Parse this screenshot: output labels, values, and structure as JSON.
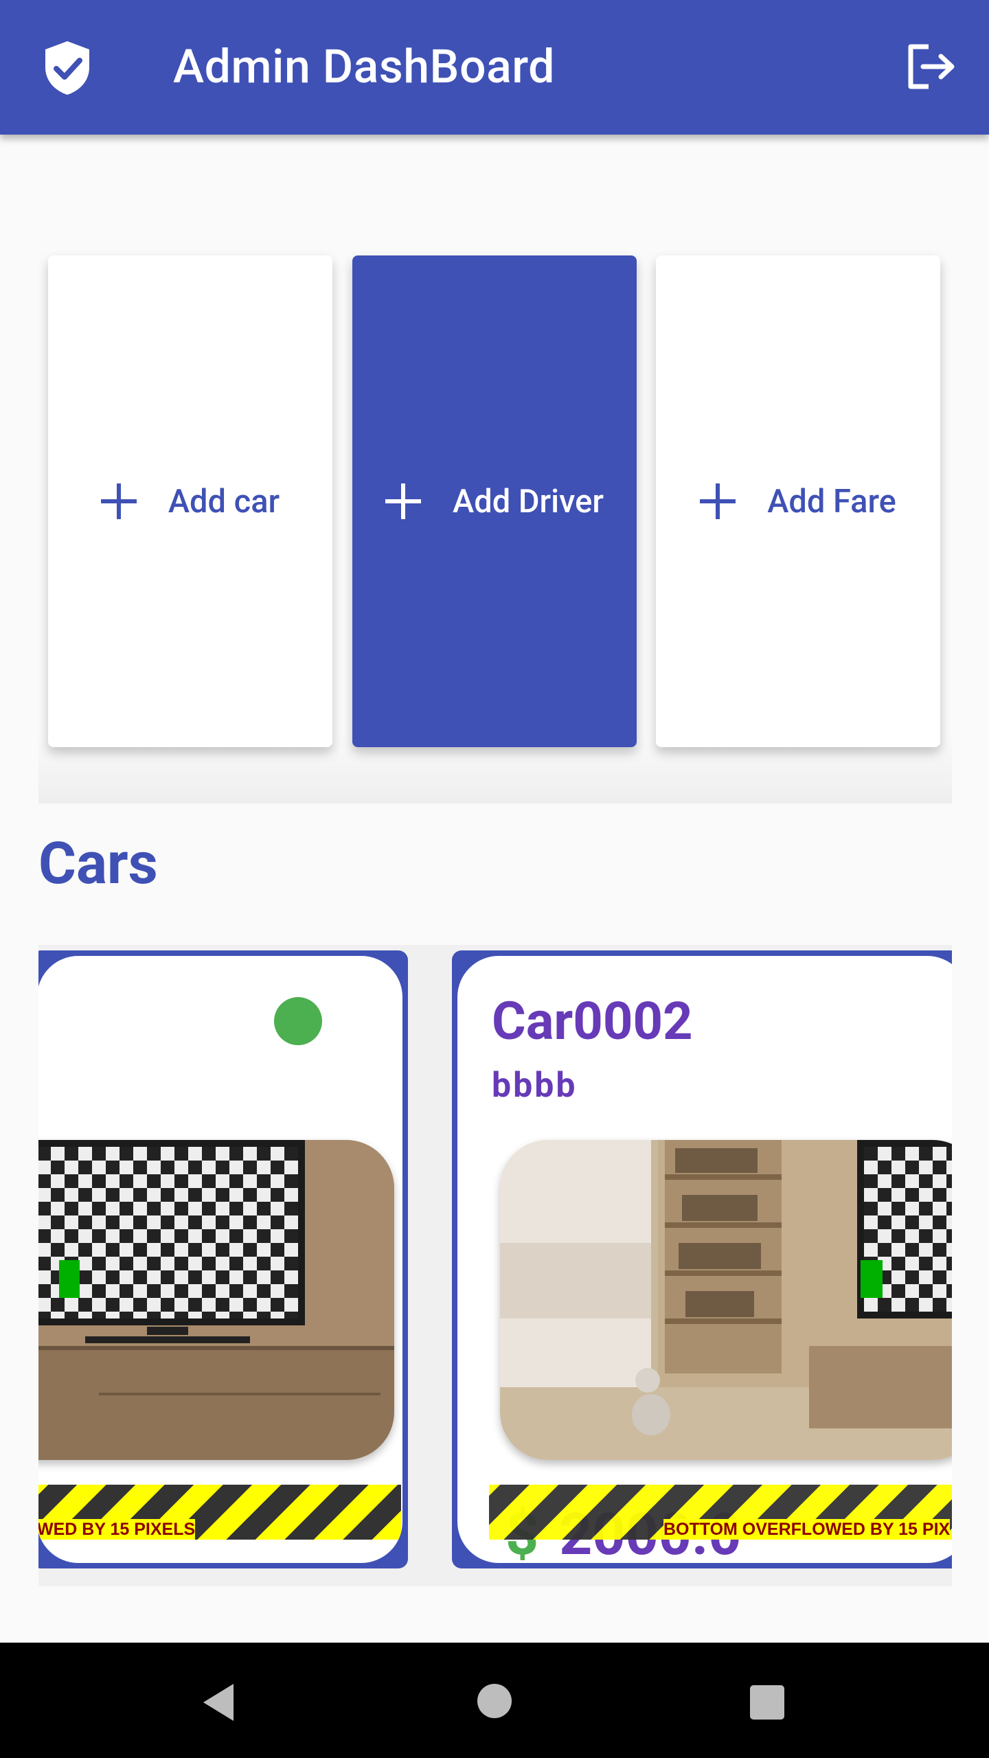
{
  "app_bar": {
    "title": "Admin DashBoard",
    "leading_icon": "verified-shield-icon",
    "trailing_icon": "logout-icon",
    "color": "#3f51b5"
  },
  "actions": [
    {
      "label": "Add car",
      "icon": "plus-icon",
      "style": "outlined"
    },
    {
      "label": "Add Driver",
      "icon": "plus-icon",
      "style": "filled"
    },
    {
      "label": "Add Fare",
      "icon": "plus-icon",
      "style": "outlined"
    }
  ],
  "cars_section": {
    "title": "Cars",
    "cars": [
      {
        "name": "",
        "subtitle": "",
        "status_color": "#4caf50",
        "overflow_warning": "WED BY 15 PIXELS"
      },
      {
        "name": "Car0002",
        "subtitle": "bbbb",
        "price_symbol": "$",
        "price": "2000.0",
        "overflow_warning": "BOTTOM OVERFLOWED BY 15 PIX"
      }
    ]
  },
  "colors": {
    "primary": "#3f51b5",
    "accent_text": "#673ab7",
    "status_green": "#4caf50"
  },
  "nav_bar": {
    "back_icon": "back-triangle-icon",
    "home_icon": "home-circle-icon",
    "recents_icon": "recents-square-icon"
  }
}
